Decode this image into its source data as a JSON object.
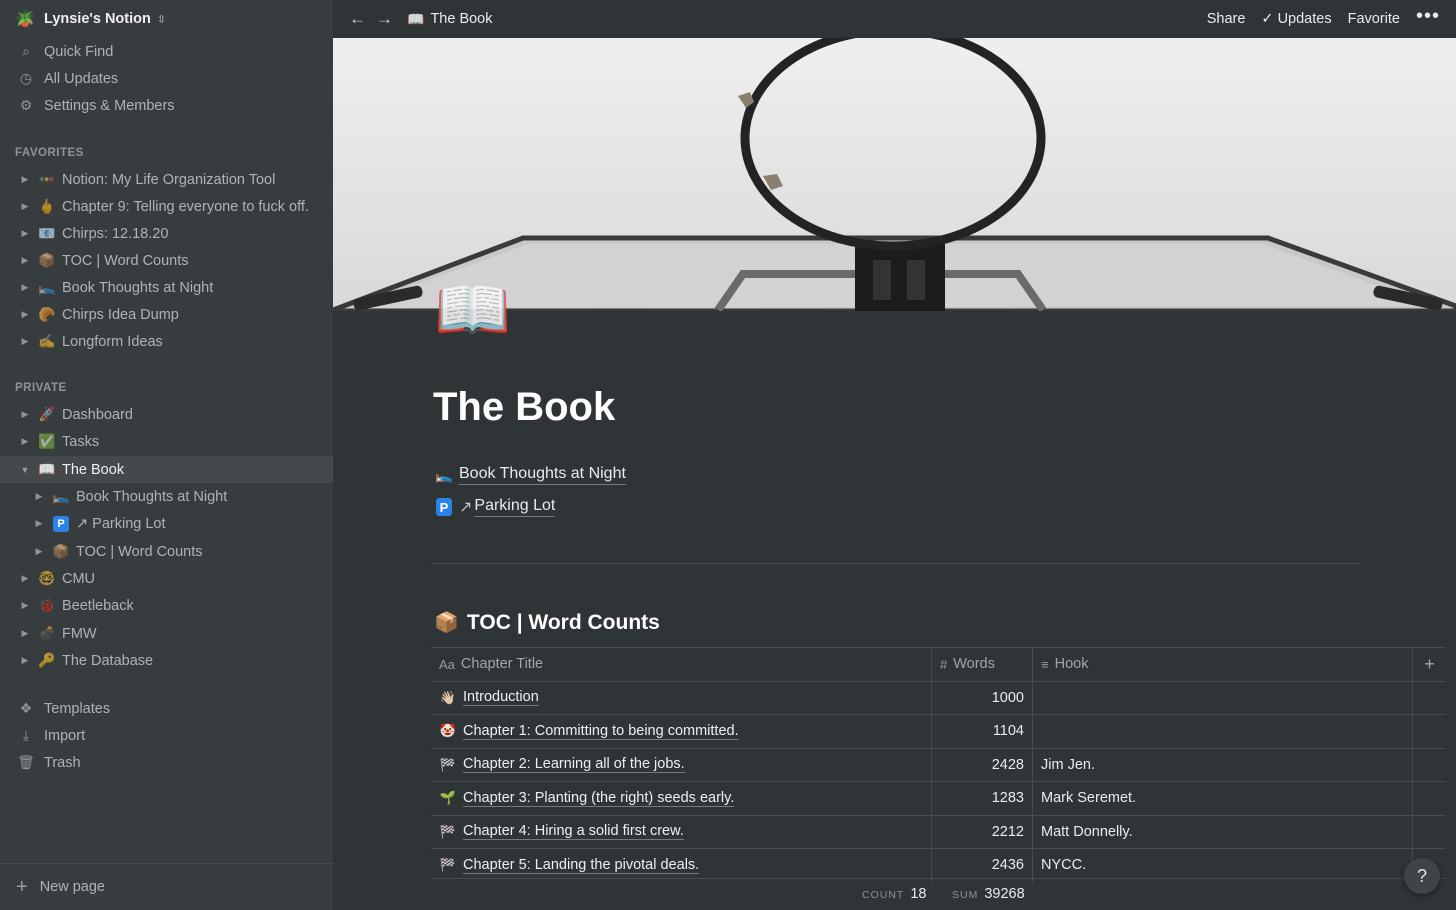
{
  "workspace": {
    "name": "Lynsie's Notion",
    "icon": "workspace-avatar-icon"
  },
  "sidebar": {
    "utilities": [
      {
        "label": "Quick Find",
        "icon": "search-icon",
        "glyph": "⌕"
      },
      {
        "label": "All Updates",
        "icon": "clock-icon",
        "glyph": "◷"
      },
      {
        "label": "Settings & Members",
        "icon": "gear-icon",
        "glyph": "⚙"
      }
    ],
    "favorites_label": "FAVORITES",
    "favorites": [
      {
        "emoji": "🚥",
        "label": "Notion: My Life Organization Tool"
      },
      {
        "emoji": "🖕",
        "label": "Chapter 9: Telling everyone to fuck off."
      },
      {
        "emoji": "📧",
        "label": "Chirps: 12.18.20"
      },
      {
        "emoji": "📦",
        "label": "TOC | Word Counts"
      },
      {
        "emoji": "🛌",
        "label": "Book Thoughts at Night"
      },
      {
        "emoji": "🥐",
        "label": "Chirps Idea Dump"
      },
      {
        "emoji": "✍️",
        "label": "Longform Ideas"
      }
    ],
    "private_label": "PRIVATE",
    "private": [
      {
        "emoji": "🚀",
        "label": "Dashboard"
      },
      {
        "emoji": "✅",
        "label": "Tasks"
      },
      {
        "emoji": "📖",
        "label": "The Book"
      },
      {
        "emoji": "🛌",
        "label": "Book Thoughts at Night"
      },
      {
        "emoji": "P",
        "label": "↗ Parking Lot"
      },
      {
        "emoji": "📦",
        "label": "TOC | Word Counts"
      },
      {
        "emoji": "🤓",
        "label": "CMU"
      },
      {
        "emoji": "🐞",
        "label": "Beetleback"
      },
      {
        "emoji": "💣",
        "label": "FMW"
      },
      {
        "emoji": "🔑",
        "label": "The Database"
      }
    ],
    "tools": [
      {
        "label": "Templates",
        "icon": "templates-icon",
        "glyph": "❖"
      },
      {
        "label": "Import",
        "icon": "import-icon",
        "glyph": "⤓"
      },
      {
        "label": "Trash",
        "icon": "trash-icon",
        "glyph": "🗑"
      }
    ],
    "new_page_label": "New page"
  },
  "topbar": {
    "breadcrumb_emoji": "📖",
    "breadcrumb": "The Book",
    "share": "Share",
    "updates": "Updates",
    "favorite": "Favorite",
    "more": "•••"
  },
  "page": {
    "icon": "📖",
    "title": "The Book",
    "links": [
      {
        "emoji": "🛌",
        "label": "Book Thoughts at Night"
      },
      {
        "emoji": "P",
        "prefix": "↗",
        "label": "Parking Lot"
      }
    ]
  },
  "database": {
    "emoji": "📦",
    "title": "TOC | Word Counts",
    "columns": [
      {
        "icon": "Aa",
        "label": "Chapter Title"
      },
      {
        "icon": "#",
        "label": "Words"
      },
      {
        "icon": "≡",
        "label": "Hook"
      }
    ],
    "rows": [
      {
        "emoji": "👋🏻",
        "title": "Introduction",
        "words": "1000",
        "hook": ""
      },
      {
        "emoji": "🤡",
        "title": "Chapter 1: Committing to being committed.",
        "words": "1104",
        "hook": ""
      },
      {
        "emoji": "🏁",
        "title": "Chapter 2: Learning all of the jobs.",
        "words": "2428",
        "hook": "Jim Jen."
      },
      {
        "emoji": "🌱",
        "title": "Chapter 3: Planting (the right) seeds early.",
        "words": "1283",
        "hook": "Mark Seremet."
      },
      {
        "emoji": "🏁",
        "title": "Chapter 4: Hiring a solid first crew.",
        "words": "2212",
        "hook": "Matt Donnelly."
      },
      {
        "emoji": "🏁",
        "title": "Chapter 5: Landing the pivotal deals.",
        "words": "2436",
        "hook": "NYCC."
      }
    ],
    "count_label": "COUNT",
    "count_value": "18",
    "sum_label": "SUM",
    "sum_value": "39268"
  },
  "help": "?"
}
